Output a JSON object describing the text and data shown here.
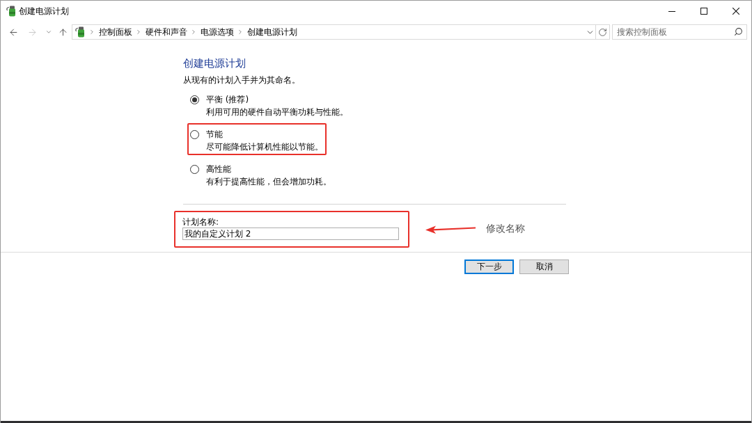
{
  "window": {
    "title": "创建电源计划"
  },
  "navigation": [
    {
      "kind": "back",
      "disabled": false
    },
    {
      "kind": "forward",
      "disabled": true
    },
    {
      "kind": "recent",
      "disabled": false
    },
    {
      "kind": "up",
      "disabled": false
    }
  ],
  "address_bar": {
    "breadcrumbs": [
      "控制面板",
      "硬件和声音",
      "电源选项",
      "创建电源计划"
    ]
  },
  "search": {
    "placeholder": "搜索控制面板"
  },
  "heading": "创建电源计划",
  "intro": "从现有的计划入手并为其命名。",
  "plans": [
    {
      "label": "平衡 (推荐)",
      "description": "利用可用的硬件自动平衡功耗与性能。",
      "selected": true,
      "highlighted": false
    },
    {
      "label": "节能",
      "description": "尽可能降低计算机性能以节能。",
      "selected": false,
      "highlighted": true
    },
    {
      "label": "高性能",
      "description": "有利于提高性能，但会增加功耗。",
      "selected": false,
      "highlighted": false
    }
  ],
  "plan_name": {
    "label": "计划名称:",
    "value": "我的自定义计划 2",
    "highlighted": true
  },
  "annotation": {
    "text": "修改名称"
  },
  "buttons": [
    {
      "label": "下一步",
      "default": true
    },
    {
      "label": "取消",
      "default": false
    }
  ]
}
